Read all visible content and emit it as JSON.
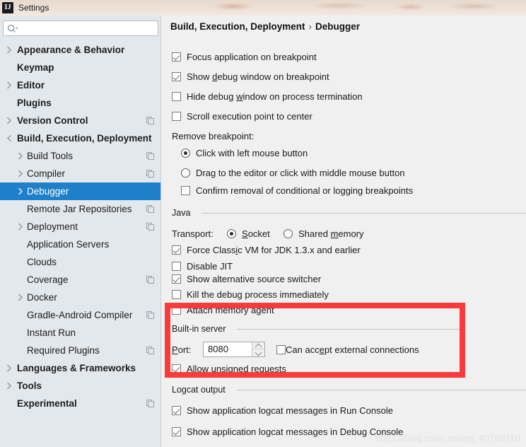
{
  "window": {
    "title": "Settings",
    "app_icon": "intellij-idea-icon",
    "titlebar_color": "#ecdfd4"
  },
  "colors": {
    "sidebar_bg": "#e3e8ec",
    "panel_bg": "#f0f0f0",
    "selection_blue": "#1d80c8",
    "annotation_red": "#f93b3b"
  },
  "search": {
    "value": "",
    "placeholder": "",
    "icon": "search-icon"
  },
  "sidebar": {
    "items": [
      {
        "label": "Appearance & Behavior",
        "level": 0,
        "arrow": "collapsed",
        "copy_icon": false,
        "selected": false
      },
      {
        "label": "Keymap",
        "level": 0,
        "arrow": "none",
        "copy_icon": false,
        "selected": false
      },
      {
        "label": "Editor",
        "level": 0,
        "arrow": "collapsed",
        "copy_icon": false,
        "selected": false
      },
      {
        "label": "Plugins",
        "level": 0,
        "arrow": "none",
        "copy_icon": false,
        "selected": false
      },
      {
        "label": "Version Control",
        "level": 0,
        "arrow": "collapsed",
        "copy_icon": true,
        "selected": false
      },
      {
        "label": "Build, Execution, Deployment",
        "level": 0,
        "arrow": "expanded",
        "copy_icon": false,
        "selected": false
      },
      {
        "label": "Build Tools",
        "level": 1,
        "arrow": "collapsed",
        "copy_icon": true,
        "selected": false
      },
      {
        "label": "Compiler",
        "level": 1,
        "arrow": "collapsed",
        "copy_icon": true,
        "selected": false
      },
      {
        "label": "Debugger",
        "level": 1,
        "arrow": "collapsed",
        "copy_icon": false,
        "selected": true
      },
      {
        "label": "Remote Jar Repositories",
        "level": 1,
        "arrow": "none",
        "copy_icon": true,
        "selected": false
      },
      {
        "label": "Deployment",
        "level": 1,
        "arrow": "collapsed",
        "copy_icon": true,
        "selected": false
      },
      {
        "label": "Application Servers",
        "level": 1,
        "arrow": "none",
        "copy_icon": false,
        "selected": false
      },
      {
        "label": "Clouds",
        "level": 1,
        "arrow": "none",
        "copy_icon": false,
        "selected": false
      },
      {
        "label": "Coverage",
        "level": 1,
        "arrow": "none",
        "copy_icon": true,
        "selected": false
      },
      {
        "label": "Docker",
        "level": 1,
        "arrow": "collapsed",
        "copy_icon": false,
        "selected": false
      },
      {
        "label": "Gradle-Android Compiler",
        "level": 1,
        "arrow": "none",
        "copy_icon": true,
        "selected": false
      },
      {
        "label": "Instant Run",
        "level": 1,
        "arrow": "none",
        "copy_icon": false,
        "selected": false
      },
      {
        "label": "Required Plugins",
        "level": 1,
        "arrow": "none",
        "copy_icon": true,
        "selected": false
      },
      {
        "label": "Languages & Frameworks",
        "level": 0,
        "arrow": "collapsed",
        "copy_icon": false,
        "selected": false
      },
      {
        "label": "Tools",
        "level": 0,
        "arrow": "collapsed",
        "copy_icon": false,
        "selected": false
      },
      {
        "label": "Experimental",
        "level": 0,
        "arrow": "none",
        "copy_icon": true,
        "selected": false
      }
    ]
  },
  "breadcrumb": {
    "parent": "Build, Execution, Deployment",
    "separator": "›",
    "current": "Debugger"
  },
  "main": {
    "checkboxes_top": [
      {
        "label": "Focus application on breakpoint",
        "checked": true,
        "mnemonic": ""
      },
      {
        "label": "Show debug window on breakpoint",
        "checked": true,
        "mnemonic": "d"
      },
      {
        "label": "Hide debug window on process termination",
        "checked": false,
        "mnemonic": "w"
      },
      {
        "label": "Scroll execution point to center",
        "checked": false,
        "mnemonic": ""
      }
    ],
    "remove_breakpoint": {
      "label": "Remove breakpoint:",
      "options": [
        {
          "label": "Click with left mouse button",
          "selected": true
        },
        {
          "label": "Drag to the editor or click with middle mouse button",
          "selected": false
        }
      ],
      "confirm": {
        "label": "Confirm removal of conditional or logging breakpoints",
        "checked": false
      }
    },
    "java_section": {
      "title": "Java",
      "transport_label": "Transport:",
      "transport_options": [
        {
          "label": "Socket",
          "selected": true,
          "mnemonic": "S"
        },
        {
          "label": "Shared memory",
          "selected": false,
          "mnemonic": "m"
        }
      ],
      "checkboxes": [
        {
          "label": "Force Classic VM for JDK 1.3.x and earlier",
          "checked": true,
          "mnemonic": "i"
        },
        {
          "label": "Disable JIT",
          "checked": false,
          "mnemonic": ""
        },
        {
          "label": "Show alternative source switcher",
          "checked": true,
          "mnemonic": ""
        },
        {
          "label": "Kill the debug process immediately",
          "checked": false,
          "mnemonic": ""
        },
        {
          "label": "Attach memory agent",
          "checked": false,
          "mnemonic": ""
        }
      ]
    },
    "builtin_server": {
      "title": "Built-in server",
      "port_label": "Port:",
      "port_value": "8080",
      "external_connections": {
        "label": "Can accept external connections",
        "checked": false,
        "mnemonic": "e"
      },
      "allow_unsigned": {
        "label": "Allow unsigned requests",
        "checked": true,
        "mnemonic": "A"
      }
    },
    "logcat_section": {
      "title": "Logcat output",
      "checkboxes": [
        {
          "label": "Show application logcat messages in Run Console",
          "checked": true
        },
        {
          "label": "Show application logcat messages in Debug Console",
          "checked": true
        }
      ]
    }
  },
  "annotation": {
    "shape": "rectangle",
    "color": "#f93b3b"
  },
  "watermark": {
    "text": "https://blog.csdn.net/qq_40709110"
  }
}
